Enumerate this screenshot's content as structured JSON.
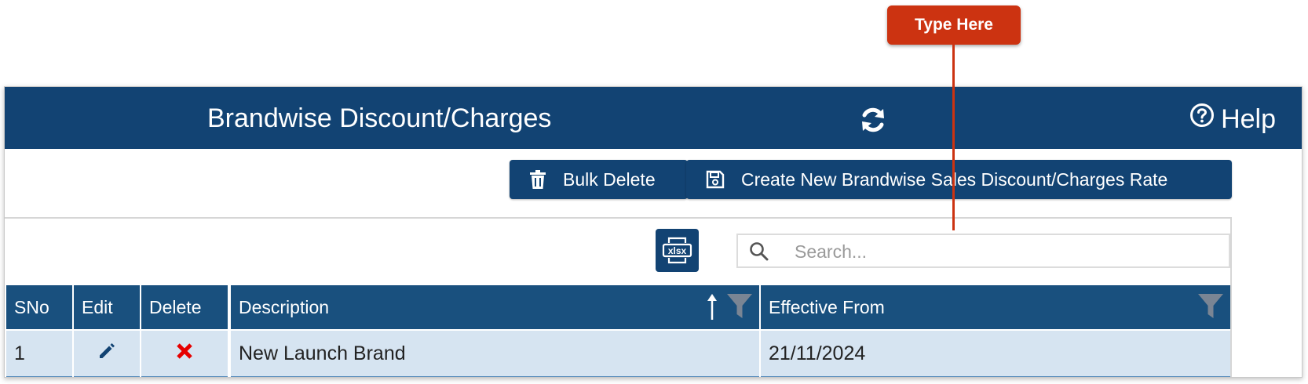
{
  "header": {
    "title": "Brandwise Discount/Charges",
    "help_label": "Help",
    "icons": {
      "refresh": "refresh-icon",
      "help": "question-circle-icon"
    }
  },
  "toolbar": {
    "bulk_delete_label": "Bulk Delete",
    "create_label": "Create New Brandwise Sales Discount/Charges Rate",
    "icons": {
      "bulk_delete": "trash-icon",
      "create": "save-icon"
    }
  },
  "grid_tools": {
    "export_icon": "xlsx-export-icon",
    "search": {
      "placeholder": "Search...",
      "value": "",
      "icon": "search-icon"
    }
  },
  "table": {
    "columns": [
      "SNo",
      "Edit",
      "Delete",
      "Description",
      "Effective From"
    ],
    "rows": [
      {
        "sno": "1",
        "edit_icon": "pencil-icon",
        "delete_icon": "red-x-icon",
        "description": "New Launch Brand",
        "effective_from": "21/11/2024"
      }
    ],
    "sort": {
      "column": "Description",
      "direction": "ascending"
    }
  },
  "callout": {
    "label": "Type Here"
  },
  "colors": {
    "header_bg": "#124373",
    "column_header_bg": "#19507e",
    "row_bg": "#d6e4f1",
    "callout": "#cc3311",
    "delete_x": "#e60000"
  }
}
